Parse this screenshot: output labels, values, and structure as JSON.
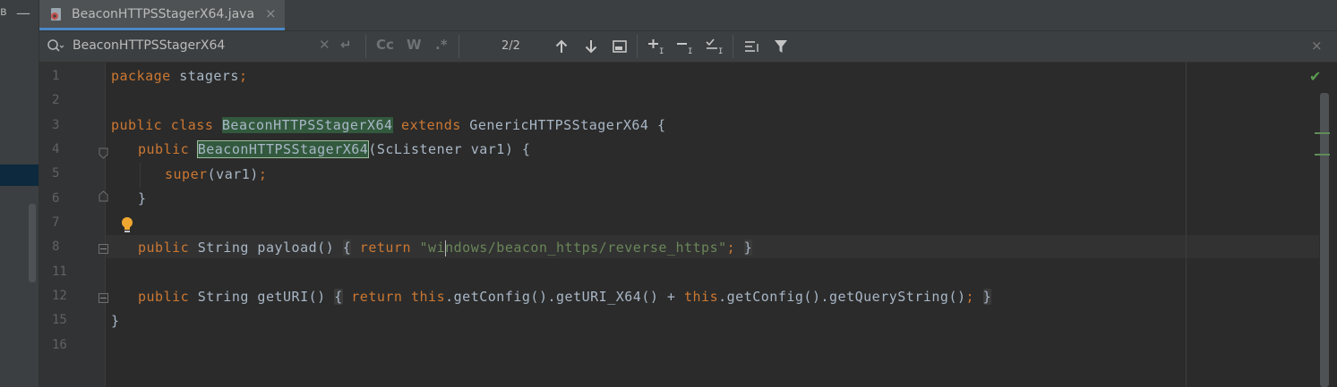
{
  "tab": {
    "filename": "BeaconHTTPSStagerX64.java",
    "close_glyph": "×"
  },
  "left": {
    "top_glyph": "в",
    "collapse_glyph": "—"
  },
  "find": {
    "query": "BeaconHTTPSStagerX64",
    "match_count": "2/2",
    "clear_glyph": "✕",
    "newline_glyph": "↵",
    "match_case": "Cc",
    "words": "W",
    "regex": ".*",
    "close_glyph": "×"
  },
  "gutter": {
    "line_numbers": [
      "1",
      "2",
      "3",
      "4",
      "5",
      "6",
      "7",
      "8",
      "11",
      "12",
      "15",
      "16"
    ]
  },
  "code": {
    "l1_kw": "package",
    "l1_name": " stagers",
    "l1_semi": ";",
    "l3_kw1": "public class ",
    "l3_cls": "BeaconHTTPSStagerX64",
    "l3_kw2": " extends",
    "l3_rest": " GenericHTTPSStagerX64 {",
    "l4_kw": "public ",
    "l4_ctor": "BeaconHTTPSStagerX64",
    "l4_rest": "(ScListener var1) {",
    "l5_kw": "super",
    "l5_args": "(var1)",
    "l5_semi": ";",
    "l6_brace": "}",
    "l8_kw": "public ",
    "l8_sig": "String payload() ",
    "l8_open": "{",
    "l8_ret": " return ",
    "l8_str_a": "\"wi",
    "l8_str_b": "ndows/beacon_https/reverse_https\"",
    "l8_semi": ";",
    "l8_close": "}",
    "l12_kw": "public ",
    "l12_sig": "String getURI() ",
    "l12_open": "{",
    "l12_ret": " return ",
    "l12_this1": "this",
    "l12_mid": ".getConfig().getURI_X64() + ",
    "l12_this2": "this",
    "l12_end": ".getConfig().getQueryString()",
    "l12_semi": ";",
    "l12_close": "}",
    "l15_brace": "}"
  },
  "status": {
    "check_glyph": "✔"
  },
  "colors": {
    "keyword": "#cc7832",
    "string": "#6a8759",
    "text": "#a9b7c6",
    "accent": "#4a88c7",
    "search_highlight": "#32593d"
  }
}
